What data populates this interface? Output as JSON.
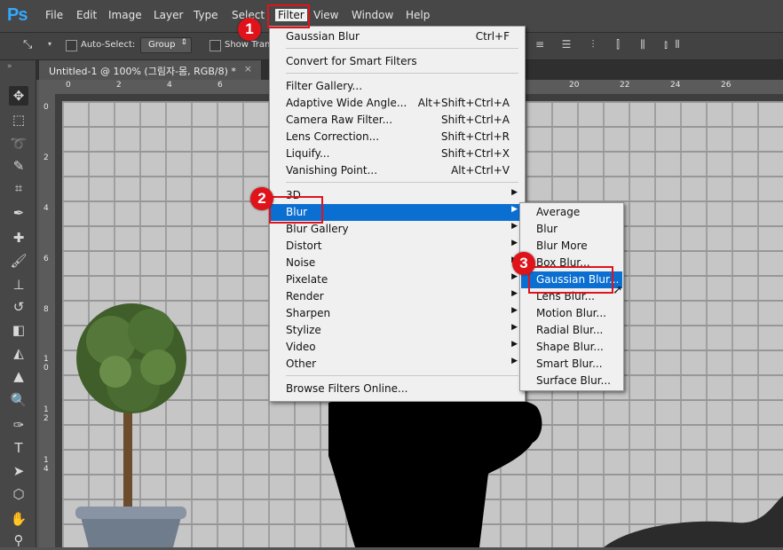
{
  "app": {
    "logo": "Ps"
  },
  "menubar": [
    "File",
    "Edit",
    "Image",
    "Layer",
    "Type",
    "Select",
    "Filter",
    "View",
    "Window",
    "Help"
  ],
  "options_bar": {
    "auto_select_label": "Auto-Select:",
    "group_value": "Group",
    "show_transform_label": "Show Tran"
  },
  "document_tab": {
    "title": "Untitled-1 @ 100% (그림자-몸, RGB/8) *",
    "close": "×"
  },
  "ruler_top": [
    "0",
    "2",
    "4",
    "6",
    "20",
    "22",
    "24",
    "26"
  ],
  "ruler_left": [
    "0",
    "2",
    "4",
    "6",
    "8",
    "1\n0",
    "1\n2",
    "1\n4"
  ],
  "filter_menu": {
    "items": [
      {
        "label": "Gaussian Blur",
        "shortcut": "Ctrl+F"
      },
      {
        "label": "Convert for Smart Filters",
        "shortcut": ""
      },
      {
        "label": "Filter Gallery...",
        "shortcut": ""
      },
      {
        "label": "Adaptive Wide Angle...",
        "shortcut": "Alt+Shift+Ctrl+A"
      },
      {
        "label": "Camera Raw Filter...",
        "shortcut": "Shift+Ctrl+A"
      },
      {
        "label": "Lens Correction...",
        "shortcut": "Shift+Ctrl+R"
      },
      {
        "label": "Liquify...",
        "shortcut": "Shift+Ctrl+X"
      },
      {
        "label": "Vanishing Point...",
        "shortcut": "Alt+Ctrl+V"
      },
      {
        "label": "3D",
        "shortcut": ""
      },
      {
        "label": "Blur",
        "shortcut": ""
      },
      {
        "label": "Blur Gallery",
        "shortcut": ""
      },
      {
        "label": "Distort",
        "shortcut": ""
      },
      {
        "label": "Noise",
        "shortcut": ""
      },
      {
        "label": "Pixelate",
        "shortcut": ""
      },
      {
        "label": "Render",
        "shortcut": ""
      },
      {
        "label": "Sharpen",
        "shortcut": ""
      },
      {
        "label": "Stylize",
        "shortcut": ""
      },
      {
        "label": "Video",
        "shortcut": ""
      },
      {
        "label": "Other",
        "shortcut": ""
      },
      {
        "label": "Browse Filters Online...",
        "shortcut": ""
      }
    ]
  },
  "blur_submenu": {
    "items": [
      "Average",
      "Blur",
      "Blur More",
      "Box Blur...",
      "Gaussian Blur...",
      "Lens Blur...",
      "Motion Blur...",
      "Radial Blur...",
      "Shape Blur...",
      "Smart Blur...",
      "Surface Blur..."
    ]
  },
  "annotations": [
    "1",
    "2",
    "3"
  ],
  "colors": {
    "highlight": "#0b6fd2",
    "annotation_red": "#e0131b",
    "ps_blue": "#31a8ff"
  }
}
